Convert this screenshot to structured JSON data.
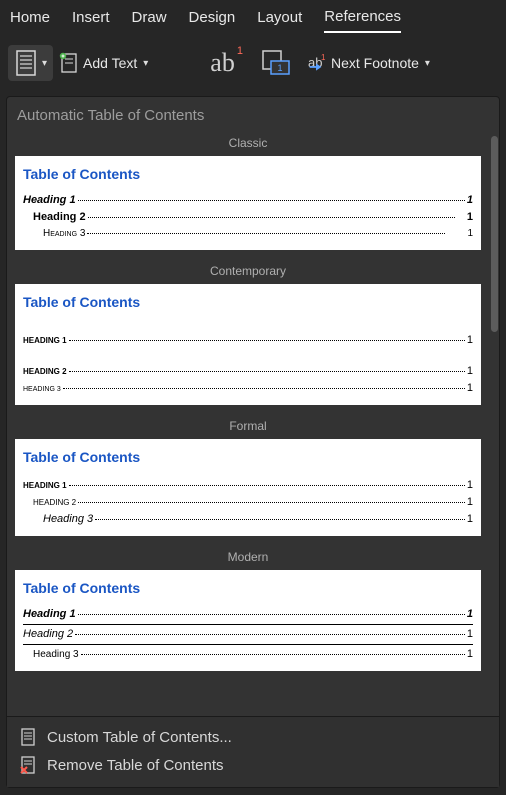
{
  "tabs": {
    "home": "Home",
    "insert": "Insert",
    "draw": "Draw",
    "design": "Design",
    "layout": "Layout",
    "references": "References"
  },
  "toolbar": {
    "add_text": "Add Text",
    "next_footnote": "Next Footnote"
  },
  "dropdown": {
    "header": "Automatic Table of Contents",
    "styles": {
      "classic": {
        "caption": "Classic",
        "title": "Table of Contents",
        "rows": [
          {
            "label": "Heading 1",
            "page": "1"
          },
          {
            "label": "Heading 2",
            "page": "1"
          },
          {
            "label": "Heading 3",
            "page": "1"
          }
        ]
      },
      "contemporary": {
        "caption": "Contemporary",
        "title": "Table of Contents",
        "rows": [
          {
            "label": "HEADING 1",
            "page": "1"
          },
          {
            "label": "HEADING 2",
            "page": "1"
          },
          {
            "label": "HEADING 3",
            "page": "1"
          }
        ]
      },
      "formal": {
        "caption": "Formal",
        "title": "Table of Contents",
        "rows": [
          {
            "label": "HEADING 1",
            "page": "1"
          },
          {
            "label": "HEADING 2",
            "page": "1"
          },
          {
            "label": "Heading 3",
            "page": "1"
          }
        ]
      },
      "modern": {
        "caption": "Modern",
        "title": "Table of Contents",
        "rows": [
          {
            "label": "Heading 1",
            "page": "1"
          },
          {
            "label": "Heading 2",
            "page": "1"
          },
          {
            "label": "Heading 3",
            "page": "1"
          }
        ]
      }
    },
    "footer": {
      "custom": "Custom Table of Contents...",
      "remove": "Remove Table of Contents"
    }
  }
}
